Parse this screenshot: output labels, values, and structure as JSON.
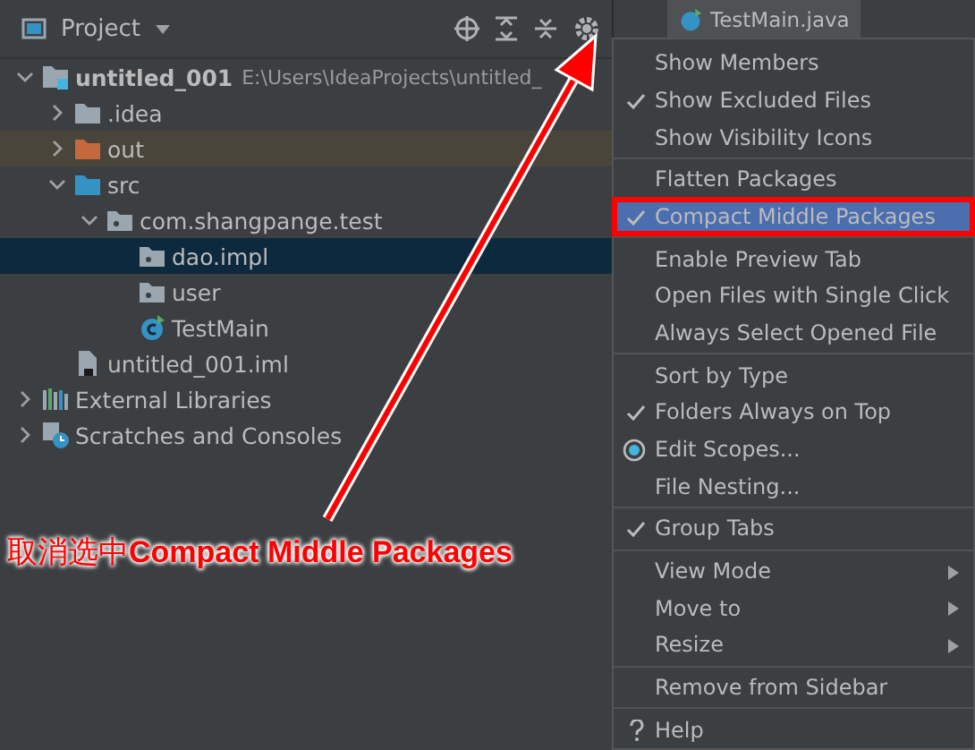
{
  "panel": {
    "title": "Project"
  },
  "editor_tab": {
    "label": "TestMain.java"
  },
  "tree": [
    {
      "label": "untitled_001",
      "kind": "project",
      "path": "E:\\Users\\IdeaProjects\\untitled_",
      "expanded": true,
      "selected": false,
      "children": [
        {
          "label": ".idea",
          "kind": "folder",
          "expanded": false,
          "selected": false
        },
        {
          "label": "out",
          "kind": "excluded-folder",
          "expanded": false,
          "selected": false
        },
        {
          "label": "src",
          "kind": "source-folder",
          "expanded": true,
          "selected": false,
          "children": [
            {
              "label": "com.shangpange.test",
              "kind": "package",
              "expanded": true,
              "selected": false,
              "children": [
                {
                  "label": "dao.impl",
                  "kind": "package",
                  "selected": true
                },
                {
                  "label": "user",
                  "kind": "package",
                  "selected": false
                },
                {
                  "label": "TestMain",
                  "kind": "class",
                  "selected": false
                }
              ]
            }
          ]
        },
        {
          "label": "untitled_001.iml",
          "kind": "file",
          "selected": false
        }
      ]
    },
    {
      "label": "External Libraries",
      "kind": "libraries",
      "expanded": false,
      "selected": false
    },
    {
      "label": "Scratches and Consoles",
      "kind": "scratches",
      "expanded": false,
      "selected": false
    }
  ],
  "menu": [
    {
      "kind": "item",
      "label": "Show Members",
      "checked": false,
      "selected": false
    },
    {
      "kind": "item",
      "label": "Show Excluded Files",
      "checked": true,
      "selected": false
    },
    {
      "kind": "item",
      "label": "Show Visibility Icons",
      "checked": false,
      "selected": false
    },
    {
      "kind": "separator"
    },
    {
      "kind": "item",
      "label": "Flatten Packages",
      "checked": false,
      "selected": false
    },
    {
      "kind": "item",
      "label": "Compact Middle Packages",
      "checked": true,
      "selected": true
    },
    {
      "kind": "separator"
    },
    {
      "kind": "item",
      "label": "Enable Preview Tab",
      "checked": false,
      "selected": false
    },
    {
      "kind": "item",
      "label": "Open Files with Single Click",
      "checked": false,
      "selected": false
    },
    {
      "kind": "item",
      "label": "Always Select Opened File",
      "checked": false,
      "selected": false
    },
    {
      "kind": "separator"
    },
    {
      "kind": "item",
      "label": "Sort by Type",
      "checked": false,
      "selected": false
    },
    {
      "kind": "item",
      "label": "Folders Always on Top",
      "checked": true,
      "selected": false
    },
    {
      "kind": "radio",
      "label": "Edit Scopes...",
      "on": true,
      "selected": false
    },
    {
      "kind": "item",
      "label": "File Nesting...",
      "checked": false,
      "selected": false
    },
    {
      "kind": "separator"
    },
    {
      "kind": "item",
      "label": "Group Tabs",
      "checked": true,
      "selected": false
    },
    {
      "kind": "separator"
    },
    {
      "kind": "submenu",
      "label": "View Mode",
      "selected": false
    },
    {
      "kind": "submenu",
      "label": "Move to",
      "selected": false
    },
    {
      "kind": "submenu",
      "label": "Resize",
      "selected": false
    },
    {
      "kind": "separator"
    },
    {
      "kind": "item",
      "label": "Remove from Sidebar",
      "checked": false,
      "selected": false
    },
    {
      "kind": "separator"
    },
    {
      "kind": "help",
      "label": "Help",
      "selected": false
    }
  ],
  "annotation": {
    "caption": "取消选中**Compact Middle Packages**"
  }
}
